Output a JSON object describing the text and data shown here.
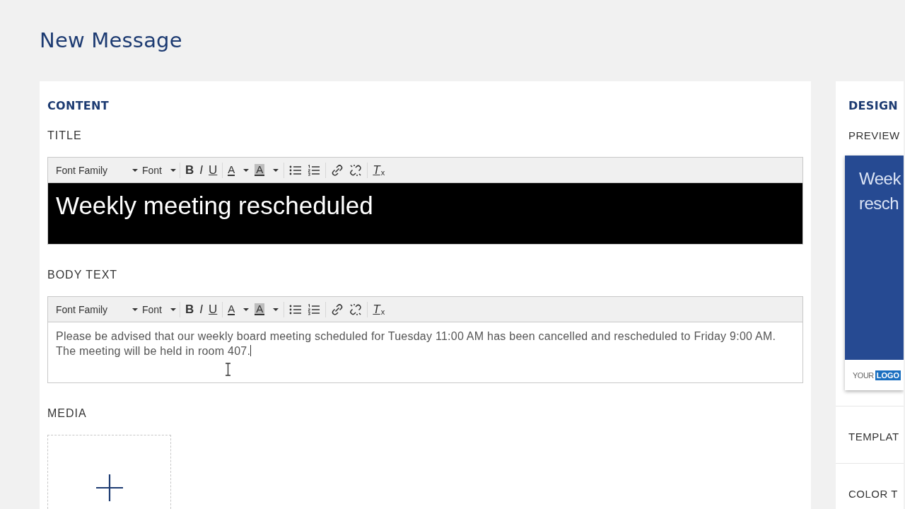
{
  "page_title": "New Message",
  "content": {
    "heading": "CONTENT",
    "title_section": {
      "label": "TITLE",
      "editor": {
        "kind": "banner",
        "focused": false,
        "value": "Weekly meeting rescheduled",
        "toolbar": [
          [
            {
              "kind": "select",
              "label": "Font Family"
            },
            {
              "kind": "select",
              "label": "Font"
            }
          ],
          [
            {
              "kind": "bold",
              "label": "B"
            },
            {
              "kind": "italic",
              "label": "I"
            },
            {
              "kind": "underline",
              "label": "U"
            }
          ],
          [
            {
              "kind": "color",
              "label": "A"
            },
            {
              "kind": "highlight",
              "label": "A"
            }
          ],
          [
            {
              "kind": "bullets"
            },
            {
              "kind": "numbers"
            }
          ],
          [
            {
              "kind": "link"
            },
            {
              "kind": "unlink"
            }
          ],
          [
            {
              "kind": "clear",
              "label": "T",
              "sub": "x"
            }
          ]
        ]
      }
    },
    "body_section": {
      "label": "BODY TEXT",
      "editor": {
        "kind": "plain",
        "focused": true,
        "value": "Please be advised that our weekly board meeting scheduled for Tuesday 11:00 AM has been cancelled and rescheduled to Friday 9:00 AM. The meeting will be held in room 407.",
        "toolbar": [
          [
            {
              "kind": "select",
              "label": "Font Family"
            },
            {
              "kind": "select",
              "label": "Font"
            }
          ],
          [
            {
              "kind": "bold",
              "label": "B"
            },
            {
              "kind": "italic",
              "label": "I"
            },
            {
              "kind": "underline",
              "label": "U"
            }
          ],
          [
            {
              "kind": "color",
              "label": "A"
            },
            {
              "kind": "highlight",
              "label": "A"
            }
          ],
          [
            {
              "kind": "bullets"
            },
            {
              "kind": "numbers"
            }
          ],
          [
            {
              "kind": "link"
            },
            {
              "kind": "unlink"
            }
          ],
          [
            {
              "kind": "clear",
              "label": "T",
              "sub": "x"
            }
          ]
        ]
      }
    },
    "media": {
      "label": "MEDIA"
    }
  },
  "design": {
    "heading": "DESIGN",
    "preview_label": "PREVIEW",
    "preview": {
      "lines": [
        "Week",
        "resch"
      ],
      "logo_prefix": "YOUR",
      "logo_badge": "LOGO"
    },
    "sections": [
      "TEMPLAT",
      "COLOR T"
    ]
  }
}
